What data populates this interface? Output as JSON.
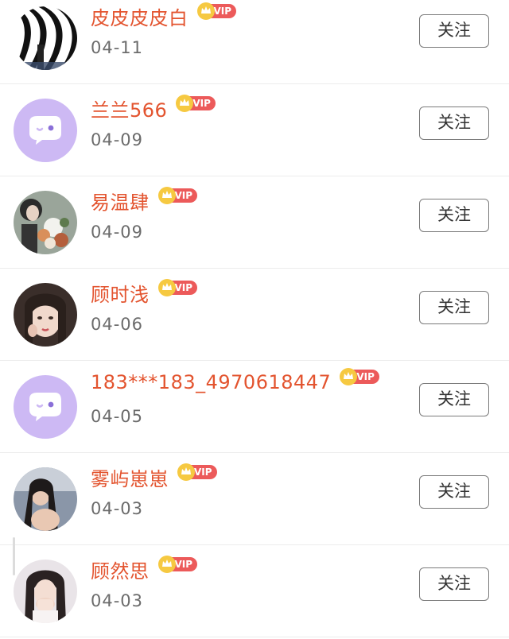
{
  "badge": {
    "vip_label": "VIP"
  },
  "actions": {
    "follow_label": "关注"
  },
  "users": [
    {
      "name": "皮皮皮皮白",
      "date": "04-11",
      "avatar": "zebra-stripe-avatar"
    },
    {
      "name": "兰兰566",
      "date": "04-09",
      "avatar": "default-chat-avatar"
    },
    {
      "name": "易温肆",
      "date": "04-09",
      "avatar": "photo-avatar-flowers"
    },
    {
      "name": "顾时浅",
      "date": "04-06",
      "avatar": "photo-avatar-girl"
    },
    {
      "name": "183***183_4970618447",
      "date": "04-05",
      "avatar": "default-chat-avatar"
    },
    {
      "name": "雾屿崽崽",
      "date": "04-03",
      "avatar": "photo-avatar-girl"
    },
    {
      "name": "顾然思",
      "date": "04-03",
      "avatar": "photo-avatar-girl"
    }
  ],
  "colors": {
    "name": "#e3542f",
    "vip_badge": "#ec5a5a",
    "crown": "#f3c131",
    "default_avatar_bg": "#cdb9f4"
  }
}
